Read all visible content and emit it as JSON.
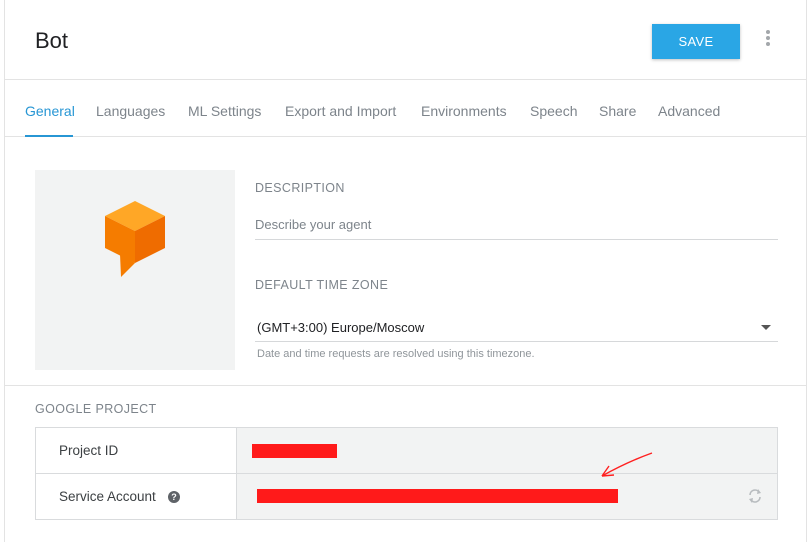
{
  "header": {
    "title": "Bot",
    "save_label": "SAVE",
    "more_icon": "more-vert-icon"
  },
  "tabs": [
    {
      "label": "General",
      "active": true
    },
    {
      "label": "Languages"
    },
    {
      "label": "ML Settings"
    },
    {
      "label": "Export and Import"
    },
    {
      "label": "Environments"
    },
    {
      "label": "Speech"
    },
    {
      "label": "Share"
    },
    {
      "label": "Advanced"
    }
  ],
  "general": {
    "description_label": "DESCRIPTION",
    "description_placeholder": "Describe your agent",
    "description_value": "",
    "timezone_label": "DEFAULT TIME ZONE",
    "timezone_value": "(GMT+3:00) Europe/Moscow",
    "timezone_hint": "Date and time requests are resolved using this timezone."
  },
  "google_project": {
    "label": "GOOGLE PROJECT",
    "rows": [
      {
        "key": "Project ID"
      },
      {
        "key": "Service Account"
      }
    ],
    "help_glyph": "?"
  },
  "colors": {
    "accent": "#2796d4",
    "save_button": "#2aa6e5",
    "redaction": "#ff1a1a",
    "avatar_orange": "#f57c00"
  }
}
